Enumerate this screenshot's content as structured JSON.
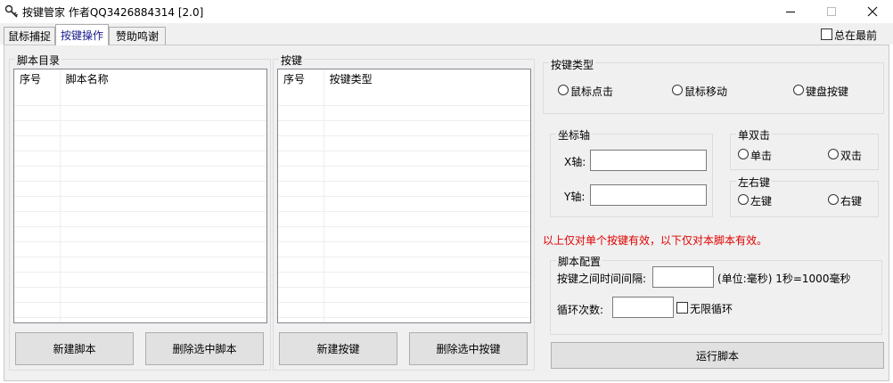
{
  "window": {
    "title": "按键管家 作者QQ3426884314  [2.0]",
    "controls": {
      "minimize": "minimize-icon",
      "maximize": "maximize-icon",
      "close": "close-icon"
    }
  },
  "tabs": [
    {
      "label": "鼠标捕捉",
      "active": false
    },
    {
      "label": "按键操作",
      "active": true
    },
    {
      "label": "赞助鸣谢",
      "active": false
    }
  ],
  "always_on_top": {
    "label": "总在最前",
    "checked": false
  },
  "script_dir": {
    "title": "脚本目录",
    "columns": [
      "序号",
      "脚本名称"
    ],
    "rows": []
  },
  "keys": {
    "title": "按键",
    "columns": [
      "序号",
      "按键类型"
    ],
    "rows": []
  },
  "buttons": {
    "new_script": "新建脚本",
    "delete_script": "删除选中脚本",
    "new_key": "新建按键",
    "delete_key": "删除选中按键",
    "run_script": "运行脚本"
  },
  "key_type": {
    "title": "按键类型",
    "options": [
      "鼠标点击",
      "鼠标移动",
      "键盘按键"
    ]
  },
  "coords": {
    "title": "坐标轴",
    "x_label": "X轴:",
    "y_label": "Y轴:",
    "x_value": "",
    "y_value": ""
  },
  "click_mode": {
    "title": "单双击",
    "options": [
      "单击",
      "双击"
    ]
  },
  "mouse_button": {
    "title": "左右键",
    "options": [
      "左键",
      "右键"
    ]
  },
  "notice": "以上仅对单个按键有效，以下仅对本脚本有效。",
  "script_config": {
    "title": "脚本配置",
    "interval_label": "按键之间时间间隔:",
    "interval_value": "",
    "interval_unit": "(单位:毫秒) 1秒=1000毫秒",
    "loop_label": "循环次数:",
    "loop_value": "",
    "infinite_label": "无限循环",
    "infinite_checked": false
  }
}
